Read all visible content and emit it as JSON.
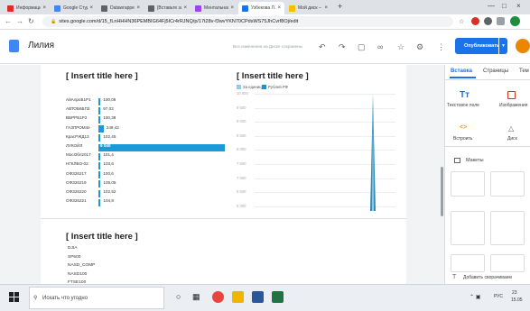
{
  "browser": {
    "tabs": [
      {
        "label": "Информационн",
        "color": "#d93025"
      },
      {
        "label": "Google Студия да",
        "color": "#4285f4"
      },
      {
        "label": "Datawrapper: cre",
        "color": "#5f6368"
      },
      {
        "label": "[Вставьте загол",
        "color": "#5f6368"
      },
      {
        "label": "Ментальная кар",
        "color": "#a142f4"
      },
      {
        "label": "Узбекова Л.А.",
        "color": "#1a73e8"
      },
      {
        "label": "Мой диск – Goo",
        "color": "#fbbc04"
      }
    ],
    "new_tab": "+",
    "url": "sites.google.com/d/15_fLnHHHN36PEMBIG64Fj5ICr4rRJNQ/p/17t28v-f3wvYKN70CPdsWS75JhCvrf8Oj/edit"
  },
  "site": {
    "name": "Лилия",
    "save_status": "Все изменения на Диске сохранены",
    "publish_label": "Опубликовать"
  },
  "page": {
    "section1_title_left": "[ Insert title here ]",
    "section1_title_right": "[ Insert title here ]",
    "section2_title": "[ Insert title here ]",
    "list_items": [
      "DJIA",
      "SP500",
      "NASD_COMP",
      "NASD100",
      "FTSE100"
    ]
  },
  "chart_data": [
    {
      "type": "bar",
      "title": "[ Insert title here ]",
      "orientation": "horizontal",
      "categories": [
        "АйАлроБ1Р1",
        "АВТОБ6БП2",
        "ВБРРБ1Р2",
        "ГАЗПРОМ4е",
        "КрасРЖД13",
        "ЛУКОЙЛ",
        "МосОбл2017",
        "НГКЛБО-02",
        "ОФЗ26217",
        "ОФЗ26219",
        "ОФЗ26220",
        "ОФЗ26221"
      ],
      "value_labels": [
        "100,06",
        "97,03",
        "100,38",
        "249,42",
        "102,45",
        "6 040",
        "101,4",
        "103,6",
        "100,6",
        "105,05",
        "102,52",
        "104,8"
      ],
      "values": [
        100.06,
        97.03,
        100.38,
        249.42,
        102.45,
        6040,
        101.4,
        103.6,
        100.6,
        105.05,
        102.52,
        104.8
      ],
      "highlight_color": "#1a9ad6"
    },
    {
      "type": "area",
      "title": "[ Insert title here ]",
      "legend": [
        "За единицу",
        "Рублей РФ"
      ],
      "legend_colors": [
        "#9ecae1",
        "#2b8cbe"
      ],
      "y_ticks": [
        "10 000",
        "9 500",
        "9 000",
        "8 500",
        "8 000",
        "7 500",
        "7 000",
        "6 500",
        "6 000"
      ],
      "ylim": [
        6000,
        10000
      ],
      "series": [
        {
          "name": "За единицу",
          "peak": 10000
        },
        {
          "name": "Рублей РФ",
          "peak": 10000
        }
      ]
    }
  ],
  "panel": {
    "tabs": [
      "Вставка",
      "Страницы",
      "Тем"
    ],
    "items": [
      "Текстовое поле",
      "Изображения",
      "Встроить",
      "Диск"
    ],
    "section_label": "Макеты",
    "footer": "Добавить сворачиваем"
  },
  "taskbar": {
    "search_placeholder": "Искать что угодно",
    "lang": "РУС",
    "time": "23",
    "date": "15.05"
  }
}
